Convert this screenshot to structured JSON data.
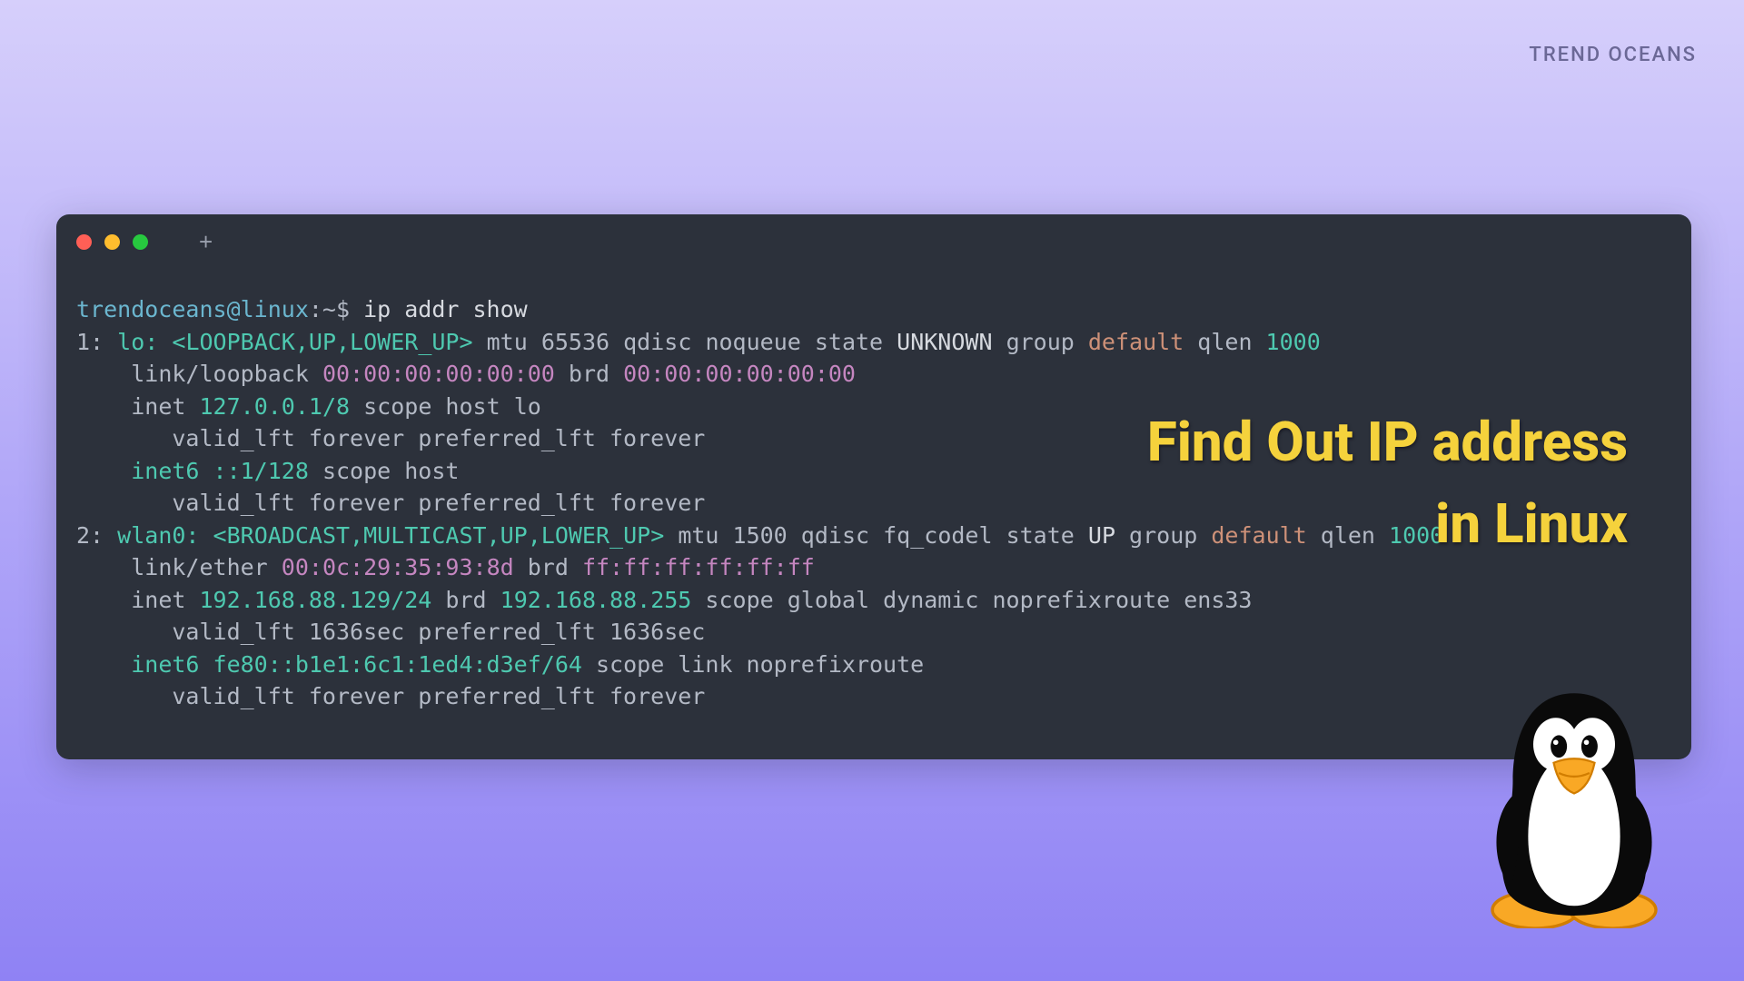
{
  "brand": "TREND OCEANS",
  "headline": {
    "line1": "Find Out IP address",
    "line2": "in Linux"
  },
  "prompt": {
    "user_host": "trendoceans@linux",
    "path": ":~$ ",
    "command": "ip addr show"
  },
  "interfaces": [
    {
      "idx": "1:",
      "name": "lo:",
      "flags": "<LOOPBACK,UP,LOWER_UP>",
      "mtu": "65536",
      "qdisc": "noqueue",
      "state": "UNKNOWN",
      "group": "default",
      "qlen": "1000",
      "link_type": "link/loopback",
      "link_mac": "00:00:00:00:00:00",
      "link_brd": "00:00:00:00:00:00",
      "inet": "127.0.0.1/8",
      "inet_scope": "scope host lo",
      "inet_lft": "valid_lft forever preferred_lft forever",
      "inet6": "::1/128",
      "inet6_scope": "scope host",
      "inet6_lft": "valid_lft forever preferred_lft forever"
    },
    {
      "idx": "2:",
      "name": "wlan0:",
      "flags": "<BROADCAST,MULTICAST,UP,LOWER_UP>",
      "mtu": "1500",
      "qdisc": "fq_codel",
      "state": "UP",
      "group": "default",
      "qlen": "1000",
      "link_type": "link/ether",
      "link_mac": "00:0c:29:35:93:8d",
      "link_brd": "ff:ff:ff:ff:ff:ff",
      "inet": "192.168.88.129/24",
      "inet_brd": "192.168.88.255",
      "inet_scope": "scope global dynamic noprefixroute ens33",
      "inet_lft": "valid_lft 1636sec preferred_lft 1636sec",
      "inet6": "fe80::b1e1:6c1:1ed4:d3ef/64",
      "inet6_scope": "scope link noprefixroute",
      "inet6_lft": "valid_lft forever preferred_lft forever"
    }
  ],
  "colors": {
    "terminal_bg": "#2c313b",
    "text": "#b3b9c5",
    "teal": "#4ec9b0",
    "orange": "#ce9178",
    "headline": "#f5d23c"
  },
  "icons": {
    "mascot": "tux-penguin-icon",
    "close": "close-icon",
    "minimize": "minimize-icon",
    "maximize": "maximize-icon",
    "newtab": "plus-icon"
  }
}
